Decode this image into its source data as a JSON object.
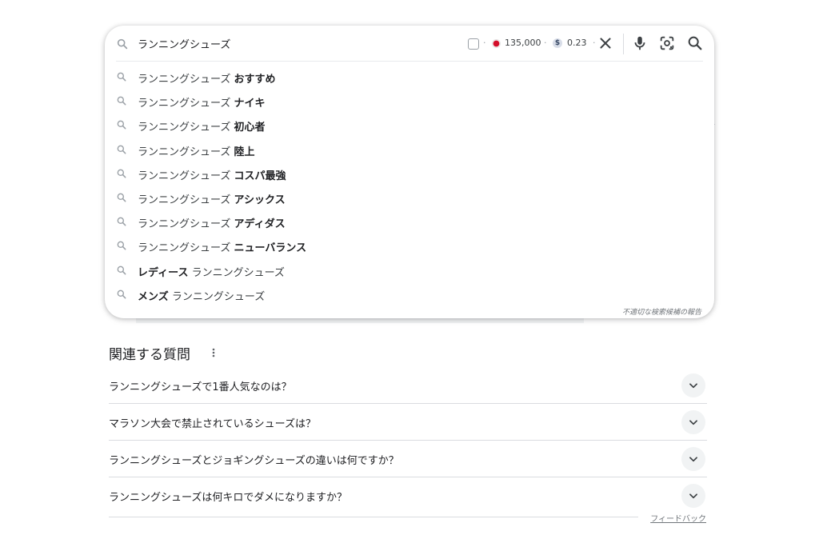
{
  "search": {
    "query": "ランニングシューズ",
    "extension": {
      "volume": "135,000",
      "cpc": "0.23",
      "currency_symbol": "$",
      "separator": "·"
    },
    "icons": {
      "search": "search-icon",
      "clear": "close-icon",
      "voice": "microphone-icon",
      "lens": "camera-lens-icon",
      "submit": "search-icon"
    }
  },
  "suggestions": [
    {
      "prefix": "ランニングシューズ ",
      "bold": "おすすめ",
      "suffix": ""
    },
    {
      "prefix": "ランニングシューズ ",
      "bold": "ナイキ",
      "suffix": ""
    },
    {
      "prefix": "ランニングシューズ ",
      "bold": "初心者",
      "suffix": ""
    },
    {
      "prefix": "ランニングシューズ ",
      "bold": "陸上",
      "suffix": ""
    },
    {
      "prefix": "ランニングシューズ ",
      "bold": "コスパ最強",
      "suffix": ""
    },
    {
      "prefix": "ランニングシューズ ",
      "bold": "アシックス",
      "suffix": ""
    },
    {
      "prefix": "ランニングシューズ ",
      "bold": "アディダス",
      "suffix": ""
    },
    {
      "prefix": "ランニングシューズ ",
      "bold": "ニューバランス",
      "suffix": ""
    },
    {
      "prefix": "",
      "bold": "レディース",
      "suffix": " ランニングシューズ"
    },
    {
      "prefix": "",
      "bold": "メンズ",
      "suffix": " ランニングシューズ"
    }
  ],
  "report_text": "不適切な検索候補の報告",
  "related_questions": {
    "title": "関連する質問",
    "items": [
      "ランニングシューズで1番人気なのは？",
      "マラソン大会で禁止されているシューズは？",
      "ランニングシューズとジョギングシューズの違いは何ですか？",
      "ランニングシューズは何キロでダメになりますか？"
    ]
  },
  "feedback_label": "フィードバック",
  "colors": {
    "text": "#202124",
    "secondary": "#70757a",
    "divider": "#dadce0",
    "jp_flag_red": "#d30f2b"
  }
}
